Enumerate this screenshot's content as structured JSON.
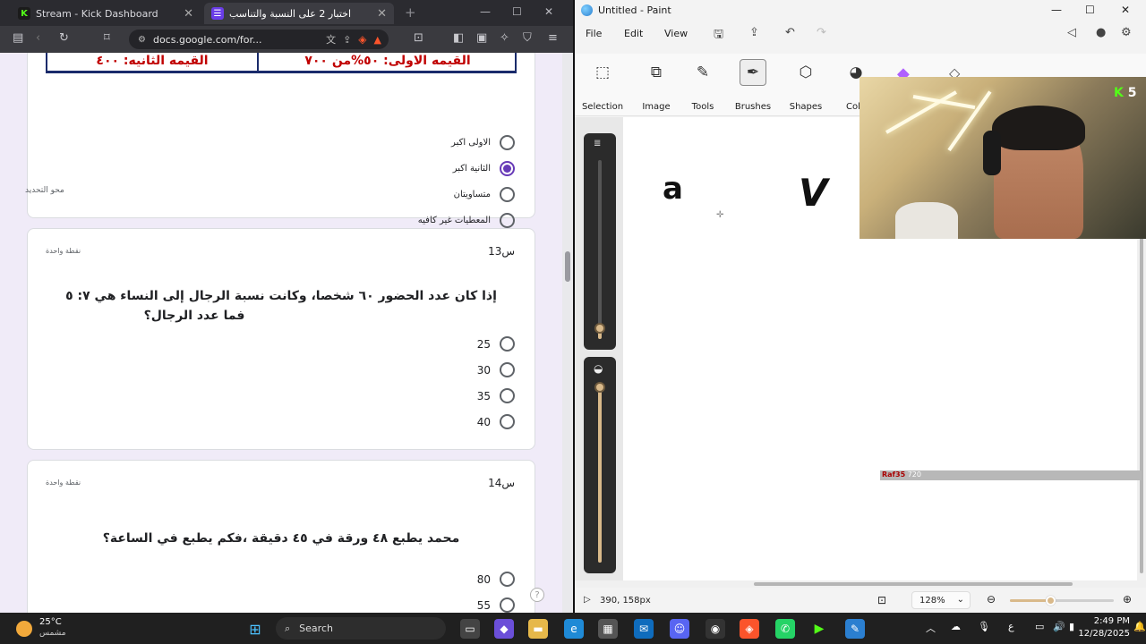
{
  "browser": {
    "tabs": [
      {
        "title": "Stream - Kick Dashboard",
        "icon": "kick-icon"
      },
      {
        "title": "اختبار 2 على النسبة والتناسب",
        "icon": "forms-icon"
      }
    ],
    "url": "docs.google.com/for...",
    "brave_badge": "3"
  },
  "form": {
    "top_card": {
      "image_cell_left": "القيمه الثانيه: ٤٠٠",
      "image_cell_right": "القيمه الاولى: ٥٠%من ٧٠٠",
      "options": [
        "الاولى اكبر",
        "الثانية اكبر",
        "متساويتان",
        "المعطيات غير كافيه"
      ],
      "selected_index": 1,
      "clear_label": "محو التحديد"
    },
    "q13": {
      "number": "س13",
      "points": "نقطة واحدة",
      "text_line1": "إذا كان عدد الحضور ٦٠ شخصا، وكانت نسبة الرجال إلى النساء هي ٧: ٥",
      "text_line2": "فما عدد الرجال؟",
      "options": [
        "25",
        "30",
        "35",
        "40"
      ]
    },
    "q14": {
      "number": "س14",
      "points": "نقطة واحدة",
      "text": "محمد يطبع ٤٨ ورقة في ٤٥ دقيقة ،فكم يطبع في الساعة؟",
      "options": [
        "80",
        "55"
      ]
    }
  },
  "paint": {
    "title": "Untitled - Paint",
    "menus": [
      "File",
      "Edit",
      "View"
    ],
    "ribbon": [
      "Selection",
      "Image",
      "Tools",
      "Brushes",
      "Shapes",
      "Colo"
    ],
    "active_tool": "Brushes",
    "canvas_glyphs": [
      "a",
      "V"
    ],
    "cursor_position": "390, 158px",
    "zoom": "128%",
    "zoom_fraction": 0.4
  },
  "overlay": {
    "kick_count": "5",
    "watermark_name": "Raf35",
    "watermark_value": "720"
  },
  "taskbar": {
    "weather_temp": "25°C",
    "weather_desc": "مشمس",
    "search_label": "Search",
    "time": "2:49 PM",
    "date": "12/28/2025",
    "lang": "ع"
  }
}
